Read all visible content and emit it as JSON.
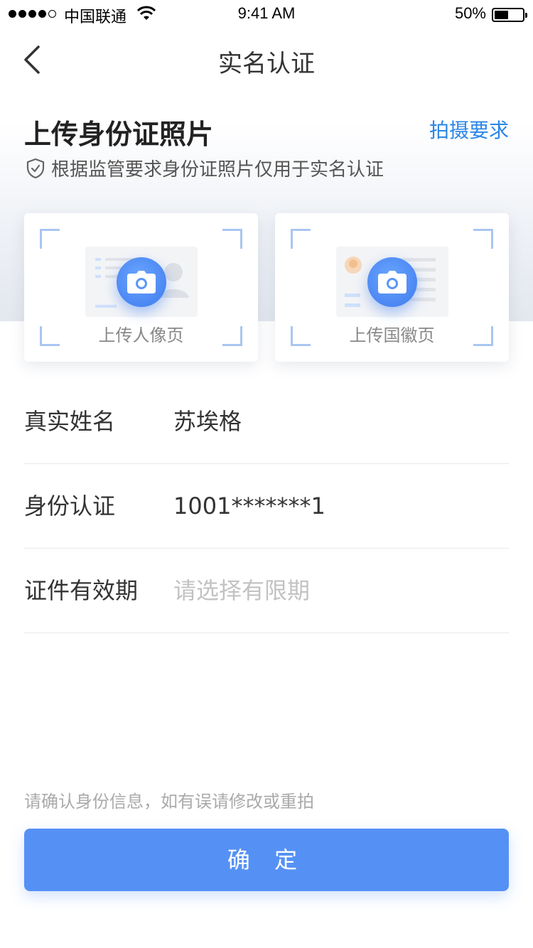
{
  "status_bar": {
    "carrier": "中国联通",
    "time": "9:41 AM",
    "battery": "50%",
    "battery_level": 0.5
  },
  "nav": {
    "title": "实名认证",
    "back_icon": "chevron-left-icon"
  },
  "upload": {
    "title": "上传身份证照片",
    "photo_requirements": "拍摄要求",
    "notice": "根据监管要求身份证照片仅用于实名认证",
    "notice_icon": "shield-check-icon",
    "cards": [
      {
        "label": "上传人像页",
        "icon": "camera-icon"
      },
      {
        "label": "上传国徽页",
        "icon": "camera-icon"
      }
    ]
  },
  "form": {
    "name": {
      "label": "真实姓名",
      "value": "苏埃格"
    },
    "id": {
      "label": "身份认证",
      "value": "1001*******1"
    },
    "validity": {
      "label": "证件有效期",
      "placeholder": "请选择有限期"
    }
  },
  "hint": "请确认身份信息，如有误请修改或重拍",
  "confirm_label": "确 定",
  "colors": {
    "accent": "#5591f5",
    "link": "#2b86e6",
    "placeholder": "#c2c2c2",
    "corner": "#a9c6f2"
  }
}
